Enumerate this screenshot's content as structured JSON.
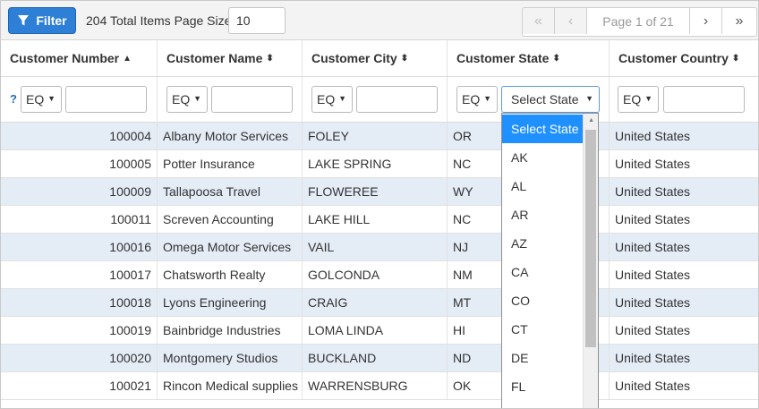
{
  "toolbar": {
    "filter_label": "Filter",
    "total_text": "204 Total Items Page Size",
    "page_size": "10",
    "page_info": "Page 1 of 21"
  },
  "columns": [
    "Customer Number",
    "Customer Name",
    "Customer City",
    "Customer State",
    "Customer Country"
  ],
  "filters": {
    "help": "?",
    "op": "EQ",
    "state_select": "Select State"
  },
  "rows": [
    {
      "number": "100004",
      "name": "Albany Motor Services",
      "city": "FOLEY",
      "state": "OR",
      "country": "United States"
    },
    {
      "number": "100005",
      "name": "Potter Insurance",
      "city": "LAKE SPRING",
      "state": "NC",
      "country": "United States"
    },
    {
      "number": "100009",
      "name": "Tallapoosa Travel",
      "city": "FLOWEREE",
      "state": "WY",
      "country": "United States"
    },
    {
      "number": "100011",
      "name": "Screven Accounting",
      "city": "LAKE HILL",
      "state": "NC",
      "country": "United States"
    },
    {
      "number": "100016",
      "name": "Omega Motor Services",
      "city": "VAIL",
      "state": "NJ",
      "country": "United States"
    },
    {
      "number": "100017",
      "name": "Chatsworth Realty",
      "city": "GOLCONDA",
      "state": "NM",
      "country": "United States"
    },
    {
      "number": "100018",
      "name": "Lyons Engineering",
      "city": "CRAIG",
      "state": "MT",
      "country": "United States"
    },
    {
      "number": "100019",
      "name": "Bainbridge Industries",
      "city": "LOMA LINDA",
      "state": "HI",
      "country": "United States"
    },
    {
      "number": "100020",
      "name": "Montgomery Studios",
      "city": "BUCKLAND",
      "state": "ND",
      "country": "United States"
    },
    {
      "number": "100021",
      "name": "Rincon Medical supplies",
      "city": "WARRENSBURG",
      "state": "OK",
      "country": "United States"
    }
  ],
  "state_options": [
    "Select State",
    "AK",
    "AL",
    "AR",
    "AZ",
    "CA",
    "CO",
    "CT",
    "DE",
    "FL"
  ],
  "colors": {
    "accent": "#2e7fd6",
    "row_alt": "#e4ecf6",
    "dropdown_active": "#1e90ff"
  }
}
